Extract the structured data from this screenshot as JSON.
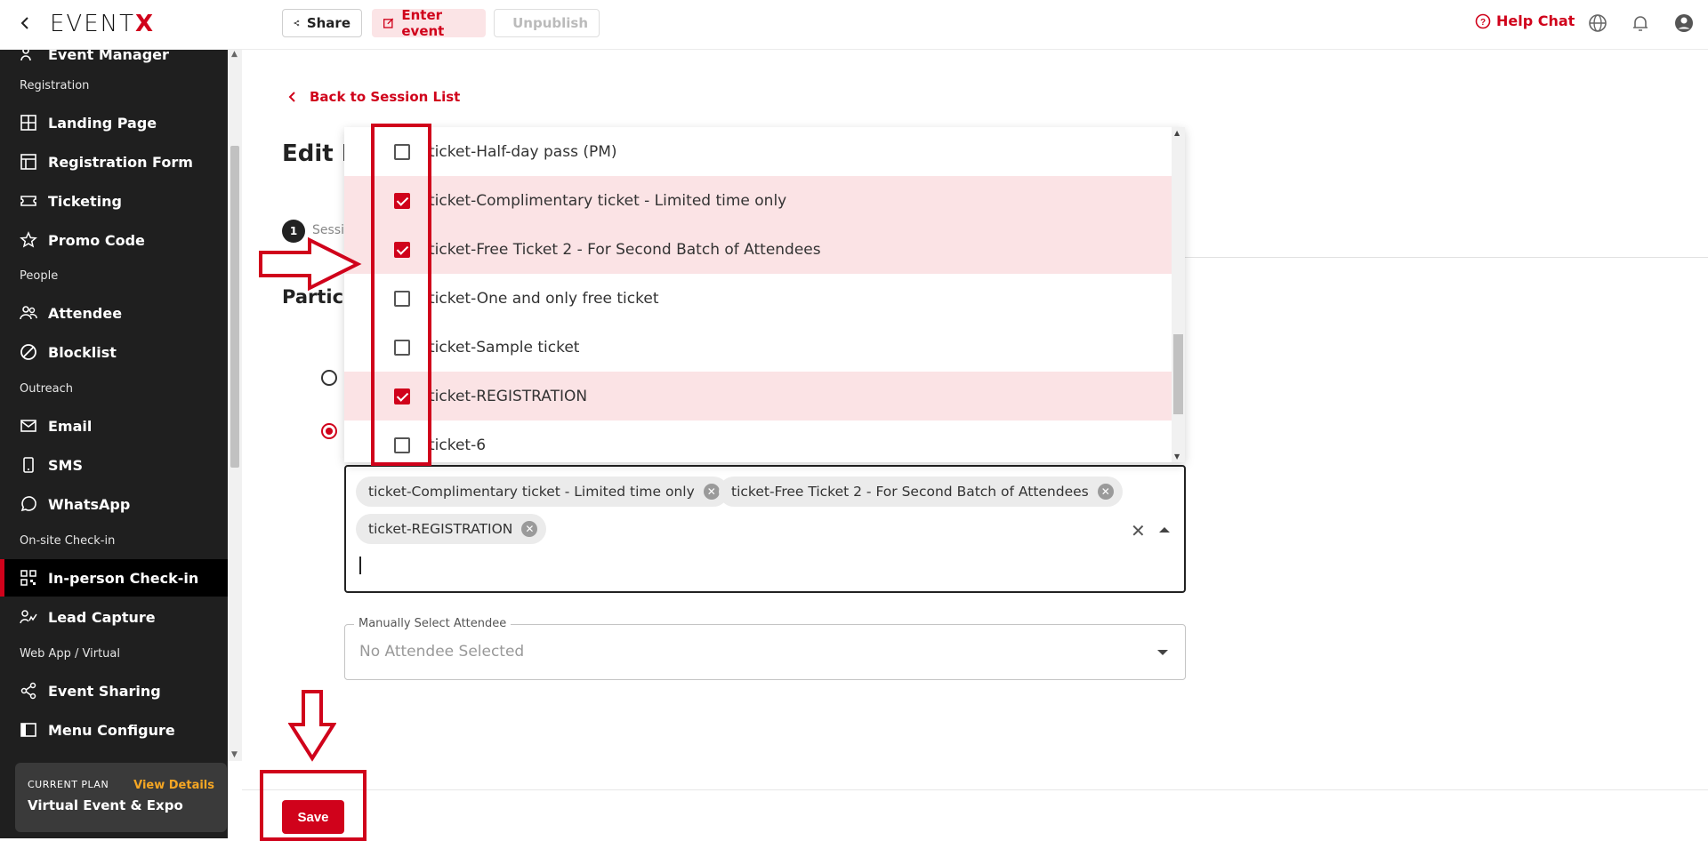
{
  "topbar": {
    "logo_main": "EVENT",
    "logo_x": "X",
    "share_label": "Share",
    "enter_label": "Enter event",
    "unpublish_label": "Unpublish",
    "help_label": "Help Chat"
  },
  "sidebar": {
    "items": [
      {
        "label": "Event Manager"
      },
      {
        "section": "Registration"
      },
      {
        "label": "Landing Page"
      },
      {
        "label": "Registration Form"
      },
      {
        "label": "Ticketing"
      },
      {
        "label": "Promo Code"
      },
      {
        "section": "People"
      },
      {
        "label": "Attendee"
      },
      {
        "label": "Blocklist"
      },
      {
        "section": "Outreach"
      },
      {
        "label": "Email"
      },
      {
        "label": "SMS"
      },
      {
        "label": "WhatsApp"
      },
      {
        "section": "On-site Check-in"
      },
      {
        "label": "In-person Check-in"
      },
      {
        "label": "Lead Capture"
      },
      {
        "section": "Web App / Virtual"
      },
      {
        "label": "Event Sharing"
      },
      {
        "label": "Menu Configure"
      }
    ],
    "plan": {
      "label": "CURRENT PLAN",
      "view_details": "View Details",
      "name": "Virtual Event & Expo"
    }
  },
  "main": {
    "back_label": "Back to Session List",
    "title": "Edit E",
    "step_number": "1",
    "step_label": "Sessi",
    "section_title": "Partici",
    "dropdown_options": [
      {
        "label": "ticket-Half-day pass (PM)",
        "checked": false
      },
      {
        "label": "ticket-Complimentary ticket - Limited time only",
        "checked": true
      },
      {
        "label": "ticket-Free Ticket 2 - For Second Batch of Attendees",
        "checked": true
      },
      {
        "label": "ticket-One and only free ticket",
        "checked": false
      },
      {
        "label": "ticket-Sample ticket",
        "checked": false
      },
      {
        "label": "ticket-REGISTRATION",
        "checked": true
      },
      {
        "label": "ticket-6",
        "checked": false
      }
    ],
    "selected_chips": [
      "ticket-Complimentary ticket - Limited time only",
      "ticket-Free Ticket 2 - For Second Batch of Attendees",
      "ticket-REGISTRATION"
    ],
    "manual_label": "Manually Select Attendee",
    "manual_placeholder": "No Attendee Selected",
    "save_label": "Save"
  },
  "colors": {
    "brand": "#d0021b",
    "selected_row": "#fbe3e5",
    "sidebar": "#1f1f1f"
  }
}
